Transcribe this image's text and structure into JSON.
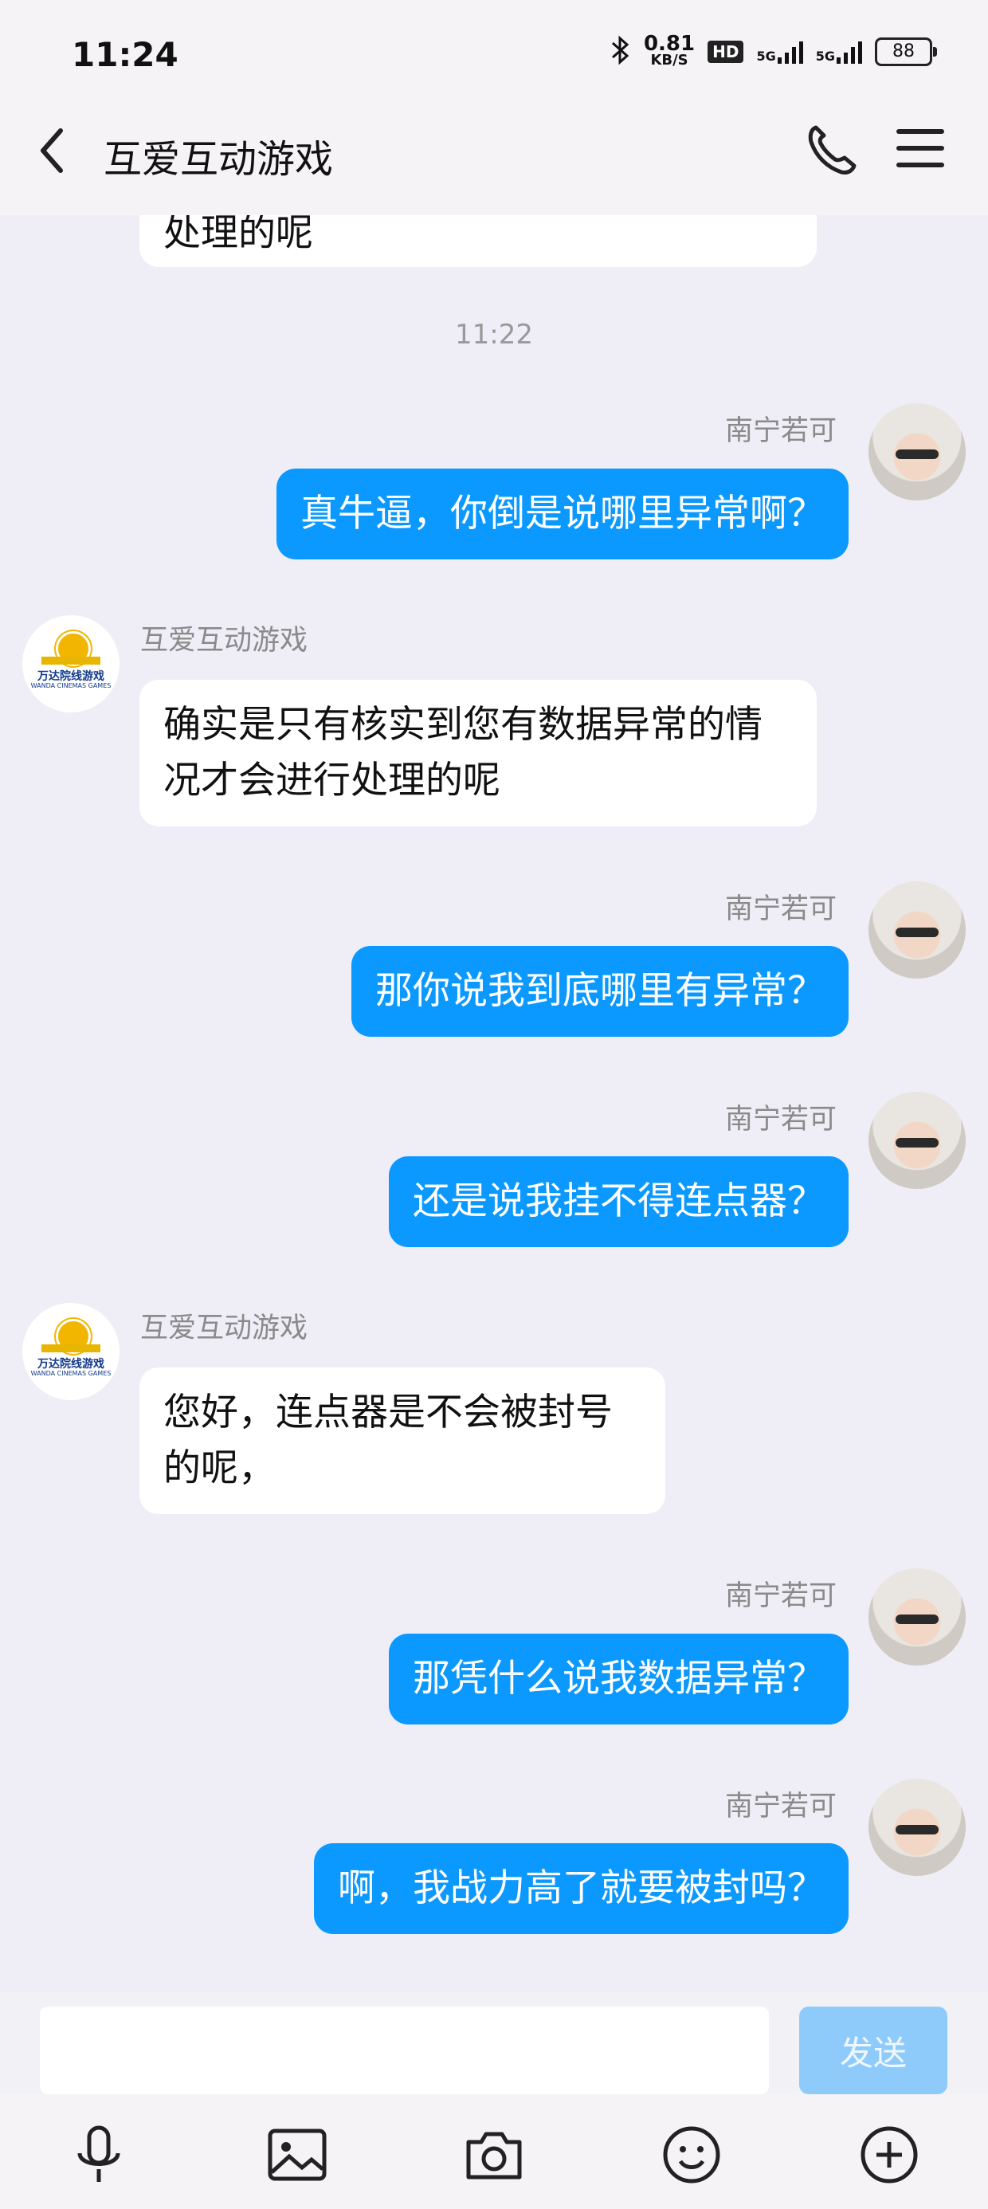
{
  "status": {
    "time": "11:24",
    "speed_value": "0.81",
    "speed_unit": "KB/S",
    "hd": "HD",
    "net1": "5G",
    "net2": "5G",
    "battery": "88"
  },
  "header": {
    "title": "互爱互动游戏"
  },
  "messages": [
    {
      "id": 0,
      "side": "in",
      "text": "处理的呢"
    },
    {
      "id": 1,
      "type": "timestamp",
      "text": "11:22"
    },
    {
      "id": 2,
      "side": "out",
      "sender": "南宁若可",
      "text": "真牛逼，你倒是说哪里异常啊？"
    },
    {
      "id": 3,
      "side": "in",
      "sender": "互爱互动游戏",
      "text": "确实是只有核实到您有数据异常的情况才会进行处理的呢"
    },
    {
      "id": 4,
      "side": "out",
      "sender": "南宁若可",
      "text": "那你说我到底哪里有异常？"
    },
    {
      "id": 5,
      "side": "out",
      "sender": "南宁若可",
      "text": "还是说我挂不得连点器？"
    },
    {
      "id": 6,
      "side": "in",
      "sender": "互爱互动游戏",
      "text": "您好，连点器是不会被封号的呢，"
    },
    {
      "id": 7,
      "side": "out",
      "sender": "南宁若可",
      "text": "那凭什么说我数据异常？"
    },
    {
      "id": 8,
      "side": "out",
      "sender": "南宁若可",
      "text": "啊，我战力高了就要被封吗？"
    }
  ],
  "brand_logo": {
    "name": "万达院线游戏",
    "sub": "WANDA CINEMAS GAMES"
  },
  "input": {
    "placeholder": "",
    "send_label": "发送"
  },
  "toolbar": {
    "icons": [
      "microphone-icon",
      "image-icon",
      "camera-icon",
      "emoji-icon",
      "plus-icon"
    ]
  },
  "colors": {
    "outgoing_bubble": "#0b99ff",
    "incoming_bubble": "#ffffff",
    "background": "#efeef7",
    "send_button": "#8fcbfa"
  }
}
